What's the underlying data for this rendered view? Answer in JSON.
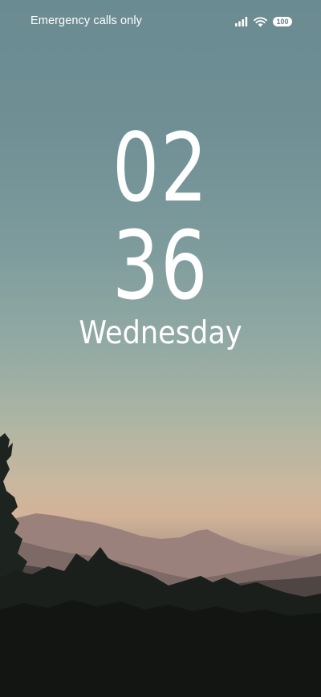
{
  "status_bar": {
    "carrier_text": "Emergency calls only",
    "signal_icon": "signal-bars-icon",
    "wifi_icon": "wifi-icon",
    "battery_icon": "battery-icon",
    "battery_level": "100"
  },
  "lock_screen": {
    "hour": "02",
    "minute": "36",
    "day": "Wednesday"
  },
  "wallpaper": {
    "description_icon": "mountain-sunset-wallpaper",
    "sky_top_color": "#6b8b92",
    "horizon_color": "#d2b398",
    "foreground_color": "#151816"
  }
}
